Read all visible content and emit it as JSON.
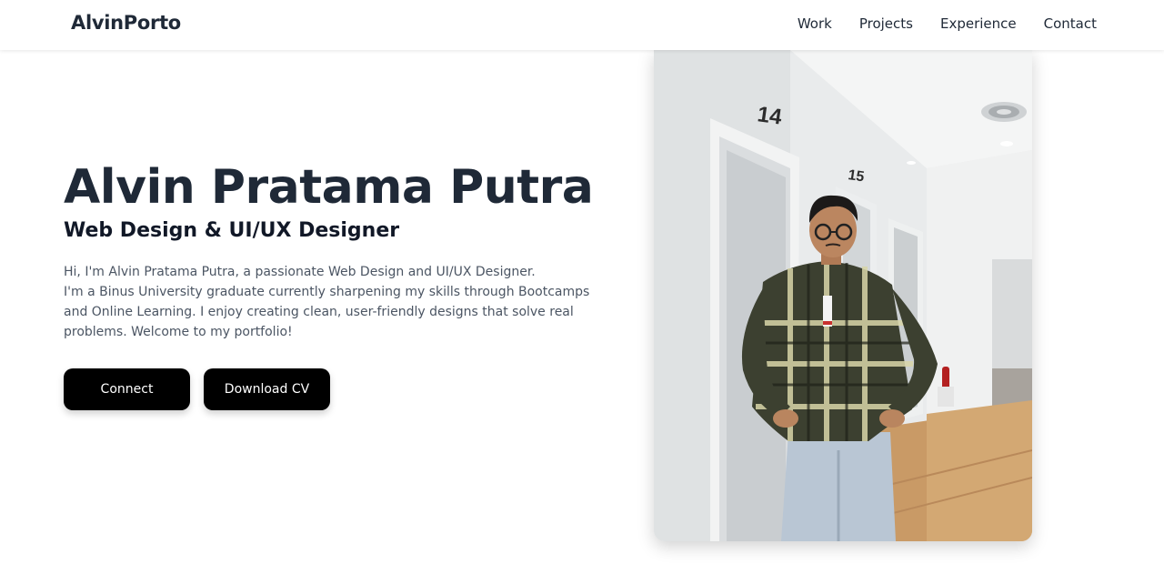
{
  "nav": {
    "logo": "AlvinPorto",
    "links": [
      "Work",
      "Projects",
      "Experience",
      "Contact"
    ]
  },
  "hero": {
    "name": "Alvin Pratama Putra",
    "role": "Web Design & UI/UX Designer",
    "bio_lines": [
      "Hi, I'm Alvin Pratama Putra, a passionate Web Design and UI/UX Designer.",
      "I'm a Binus University graduate currently sharpening my skills through Bootcamps and Online Learning. I enjoy creating clean, user-friendly designs that solve real problems. Welcome to my portfolio!"
    ],
    "buttons": {
      "connect": "Connect",
      "download_cv": "Download CV"
    }
  },
  "photo": {
    "door_numbers": [
      "14",
      "15"
    ]
  },
  "colors": {
    "primary_text": "#1f2937",
    "body_text": "#4b5563",
    "button_bg": "#000000",
    "button_text": "#ffffff"
  }
}
